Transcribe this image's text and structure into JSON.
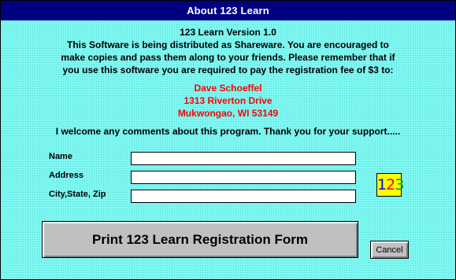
{
  "window": {
    "title": "About 123 Learn"
  },
  "intro": {
    "version": "123 Learn Version 1.0",
    "lines": [
      "This Software is being distributed as Shareware.  You are encouraged to",
      "make copies and pass them along to your friends.  Please remember that if",
      "you use this software you are required to pay the registration fee of $3 to:"
    ]
  },
  "address": {
    "name": "Dave Schoeffel",
    "street": "1313 Riverton Drive",
    "city": "Mukwongao, WI  53149"
  },
  "welcome": "I welcome any comments about this program.  Thank you for your support.....",
  "form": {
    "name_label": "Name",
    "address_label": "Address",
    "city_label": "City,State, Zip",
    "name_value": "",
    "address_value": "",
    "city_value": ""
  },
  "logo": {
    "digits": [
      "1",
      "2",
      "3"
    ],
    "colors": [
      "#0000ff",
      "#ff0000",
      "#00a000"
    ],
    "background": "#ffff00"
  },
  "buttons": {
    "print_label": "Print 123 Learn Registration Form",
    "cancel_label": "Cancel"
  },
  "colors": {
    "titlebar": "#000080",
    "background": "#7ffbf4",
    "address_text": "#ff0000"
  }
}
